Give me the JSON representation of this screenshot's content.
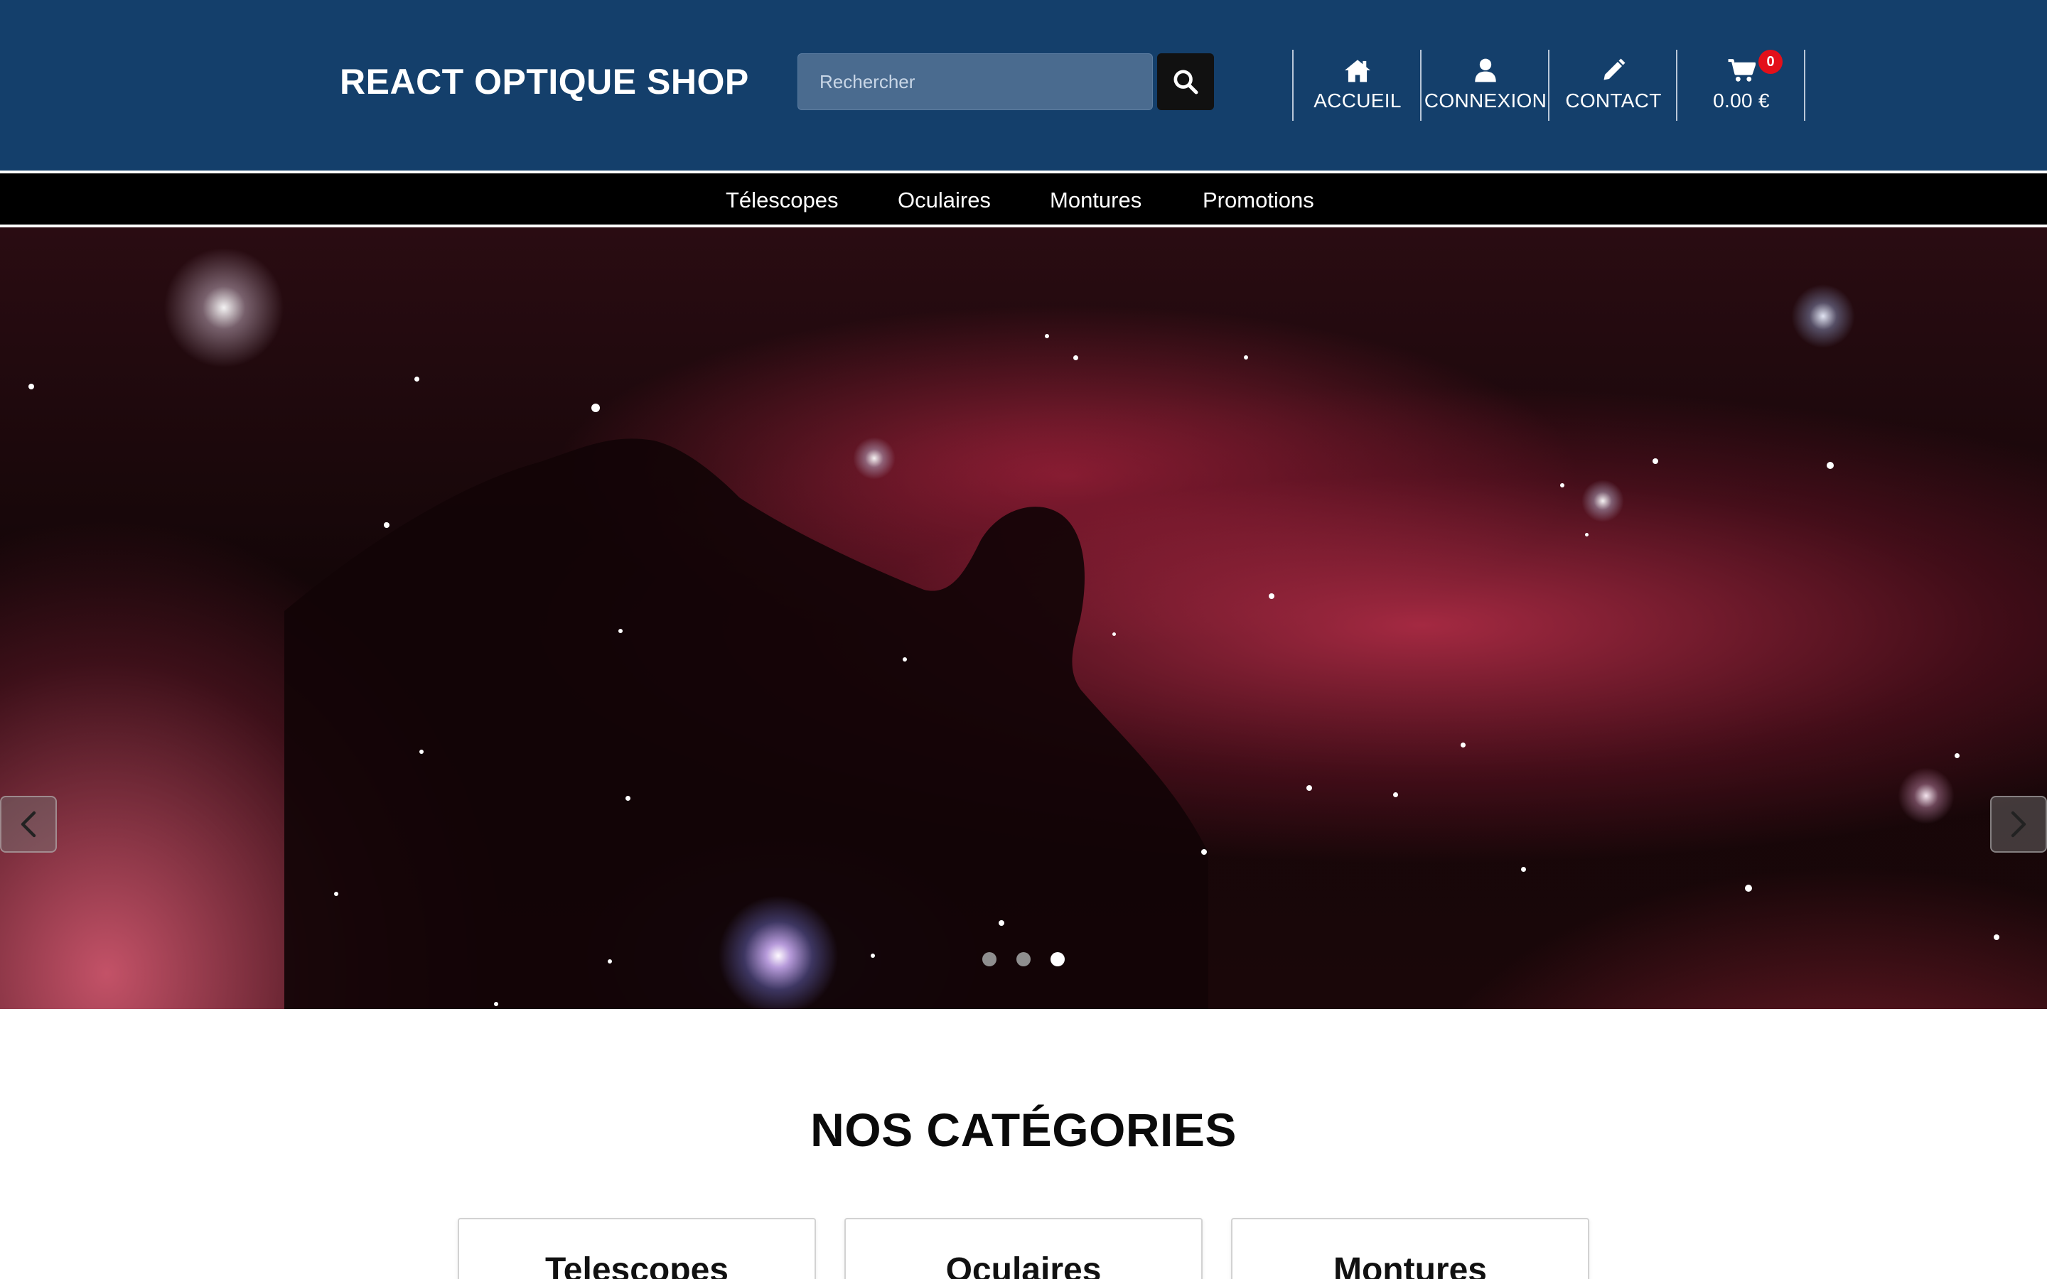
{
  "header": {
    "brand": "REACT OPTIQUE SHOP",
    "search": {
      "placeholder": "Rechercher",
      "value": ""
    },
    "nav": [
      {
        "label": "ACCUEIL",
        "icon": "home-icon"
      },
      {
        "label": "CONNEXION",
        "icon": "user-icon"
      },
      {
        "label": "CONTACT",
        "icon": "pencil-icon"
      }
    ],
    "cart": {
      "total": "0.00 €",
      "count": "0",
      "icon": "cart-icon"
    },
    "colors": {
      "background": "#143f6b",
      "search_bg": "#4a6b8f",
      "badge": "#e3101a"
    }
  },
  "category_bar": {
    "items": [
      "Télescopes",
      "Oculaires",
      "Montures",
      "Promotions"
    ]
  },
  "carousel": {
    "slide_count": 3,
    "active_slide": 3,
    "prev_icon": "chevron-left-icon",
    "next_icon": "chevron-right-icon"
  },
  "categories": {
    "title": "NOS CATÉGORIES",
    "cards": [
      "Telescopes",
      "Oculaires",
      "Montures"
    ]
  }
}
